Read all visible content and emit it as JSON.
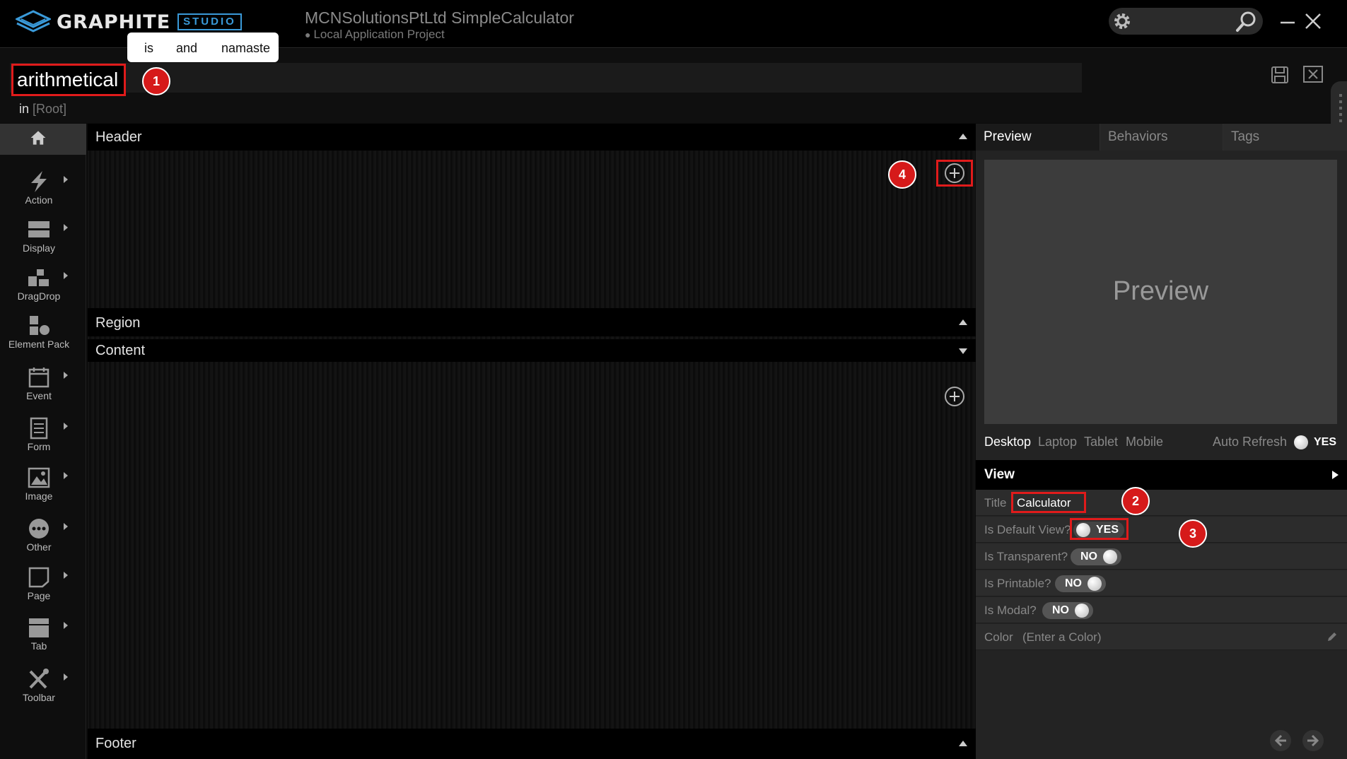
{
  "app": {
    "logo_text": "GRAPHITE",
    "logo_badge": "STUDIO",
    "project_title": "MCNSolutionsPtLtd SimpleCalculator",
    "project_subtitle": "Local Application Project"
  },
  "suggestions": [
    "is",
    "and",
    "namaste"
  ],
  "view_name": {
    "value": "arithmetical",
    "in_label": "in",
    "location": "[Root]"
  },
  "toolbar": {
    "items": [
      {
        "label": "Action",
        "icon": "lightning-icon"
      },
      {
        "label": "Display",
        "icon": "display-icon"
      },
      {
        "label": "DragDrop",
        "icon": "dragdrop-icon"
      },
      {
        "label": "Element Pack",
        "icon": "element-pack-icon"
      },
      {
        "label": "Event",
        "icon": "calendar-icon"
      },
      {
        "label": "Form",
        "icon": "form-icon"
      },
      {
        "label": "Image",
        "icon": "image-icon"
      },
      {
        "label": "Other",
        "icon": "more-icon"
      },
      {
        "label": "Page",
        "icon": "page-icon"
      },
      {
        "label": "Tab",
        "icon": "tab-icon"
      },
      {
        "label": "Toolbar",
        "icon": "tools-icon"
      }
    ]
  },
  "canvas": {
    "header": "Header",
    "region": "Region",
    "content": "Content",
    "footer": "Footer"
  },
  "right_panel": {
    "tabs": [
      "Preview",
      "Behaviors",
      "Tags"
    ],
    "preview_placeholder": "Preview",
    "devices": [
      "Desktop",
      "Laptop",
      "Tablet",
      "Mobile"
    ],
    "auto_refresh_label": "Auto Refresh",
    "auto_refresh_value": "YES",
    "view_section": "View",
    "props": {
      "title_label": "Title",
      "title_value": "Calculator",
      "default_view_label": "Is Default View?",
      "default_view_value": "YES",
      "transparent_label": "Is Transparent?",
      "transparent_value": "NO",
      "printable_label": "Is Printable?",
      "printable_value": "NO",
      "modal_label": "Is Modal?",
      "modal_value": "NO",
      "color_label": "Color",
      "color_placeholder": "(Enter a Color)"
    }
  },
  "callouts": [
    "1",
    "2",
    "3",
    "4"
  ],
  "colors": {
    "highlight": "#e01b1b",
    "callout": "#d61a1a",
    "brand_blue": "#3a9ad9"
  }
}
